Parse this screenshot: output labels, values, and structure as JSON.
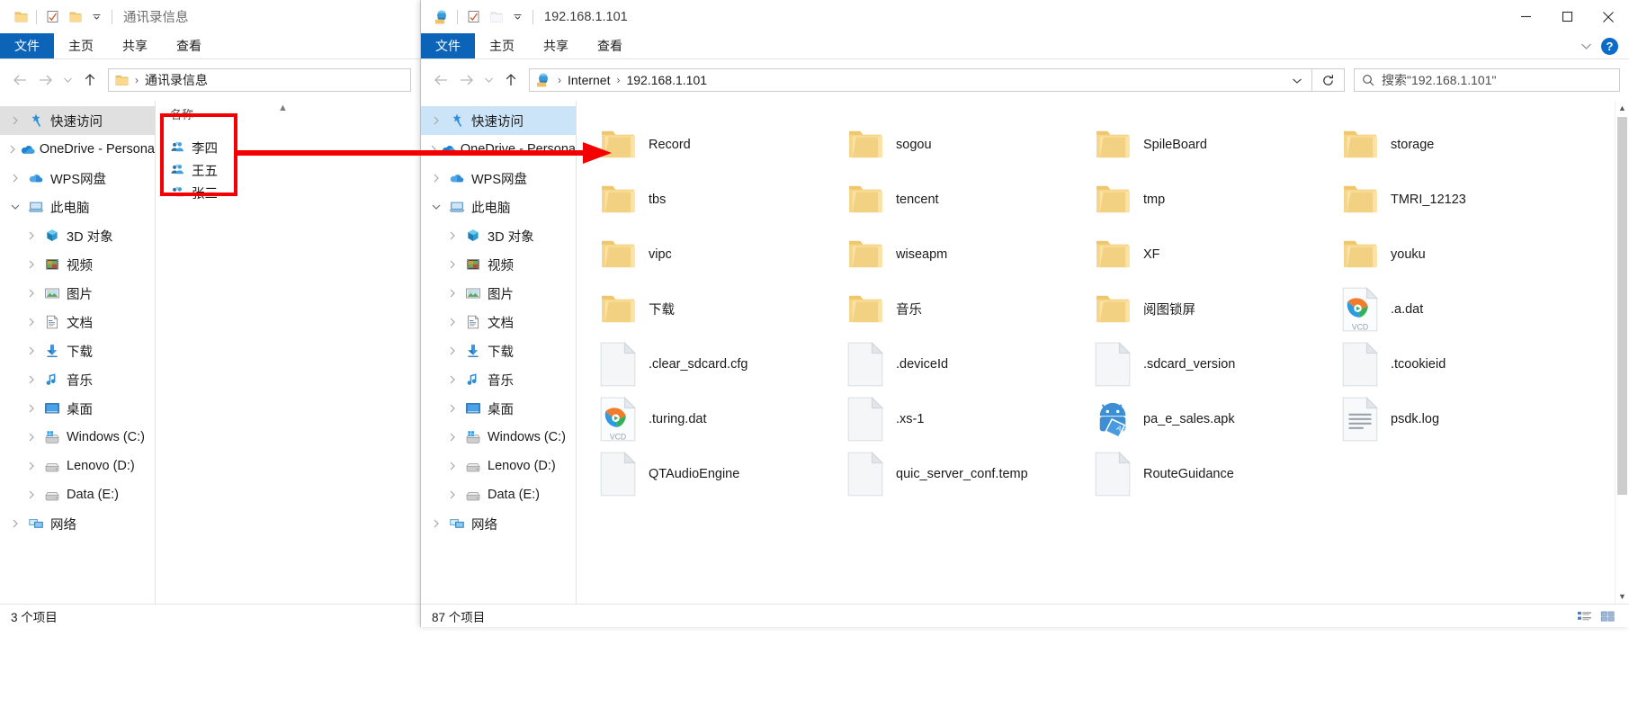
{
  "left_window": {
    "title": "通讯录信息",
    "quick_access_icons": [
      "folder-icon",
      "properties-icon",
      "new-folder-icon",
      "customize-qat-chevron"
    ],
    "ribbon_tabs": [
      "文件",
      "主页",
      "共享",
      "查看"
    ],
    "address": {
      "root_icon": "folder-icon",
      "crumbs": [
        "通讯录信息"
      ]
    },
    "nav_tree": [
      {
        "label": "快速访问",
        "icon": "star-pin-icon",
        "indent": 0,
        "expander": "chevron-right",
        "selected": true
      },
      {
        "label": "OneDrive - Persona",
        "icon": "onedrive-icon",
        "indent": 0,
        "expander": "chevron-right"
      },
      {
        "label": "WPS网盘",
        "icon": "wps-cloud-icon",
        "indent": 0,
        "expander": "chevron-right"
      },
      {
        "label": "此电脑",
        "icon": "this-pc-icon",
        "indent": 0,
        "expander": "chevron-down"
      },
      {
        "label": "3D 对象",
        "icon": "3d-objects-icon",
        "indent": 1,
        "expander": "chevron-right"
      },
      {
        "label": "视频",
        "icon": "videos-icon",
        "indent": 1,
        "expander": "chevron-right"
      },
      {
        "label": "图片",
        "icon": "pictures-icon",
        "indent": 1,
        "expander": "chevron-right"
      },
      {
        "label": "文档",
        "icon": "documents-icon",
        "indent": 1,
        "expander": "chevron-right"
      },
      {
        "label": "下载",
        "icon": "downloads-icon",
        "indent": 1,
        "expander": "chevron-right"
      },
      {
        "label": "音乐",
        "icon": "music-icon",
        "indent": 1,
        "expander": "chevron-right"
      },
      {
        "label": "桌面",
        "icon": "desktop-icon",
        "indent": 1,
        "expander": "chevron-right"
      },
      {
        "label": "Windows (C:)",
        "icon": "windows-drive-icon",
        "indent": 1,
        "expander": "chevron-right"
      },
      {
        "label": "Lenovo (D:)",
        "icon": "drive-icon",
        "indent": 1,
        "expander": "chevron-right"
      },
      {
        "label": "Data (E:)",
        "icon": "drive-icon",
        "indent": 1,
        "expander": "chevron-right"
      },
      {
        "label": "网络",
        "icon": "network-icon",
        "indent": 0,
        "expander": "chevron-right"
      }
    ],
    "list_header": "名称",
    "list_items": [
      {
        "label": "李四",
        "icon": "contact-group-icon"
      },
      {
        "label": "王五",
        "icon": "contact-group-icon"
      },
      {
        "label": "张三",
        "icon": "contact-group-icon"
      }
    ],
    "status": "3 个项目"
  },
  "right_window": {
    "title": "192.168.1.101",
    "quick_access_icons": [
      "portable-device-icon",
      "properties-icon",
      "new-folder-icon",
      "customize-qat-chevron"
    ],
    "ribbon_tabs": [
      "文件",
      "主页",
      "共享",
      "查看"
    ],
    "help_label": "?",
    "window_controls": {
      "minimize": "minimize-icon",
      "maximize": "maximize-icon",
      "close": "close-icon"
    },
    "address": {
      "root_icon": "portable-device-icon",
      "crumbs": [
        "Internet",
        "192.168.1.101"
      ]
    },
    "search_placeholder": "搜索\"192.168.1.101\"",
    "nav_tree": [
      {
        "label": "快速访问",
        "icon": "star-pin-icon",
        "indent": 0,
        "expander": "chevron-right",
        "selected": true
      },
      {
        "label": "OneDrive - Persona",
        "icon": "onedrive-icon",
        "indent": 0,
        "expander": "chevron-right"
      },
      {
        "label": "WPS网盘",
        "icon": "wps-cloud-icon",
        "indent": 0,
        "expander": "chevron-right"
      },
      {
        "label": "此电脑",
        "icon": "this-pc-icon",
        "indent": 0,
        "expander": "chevron-down"
      },
      {
        "label": "3D 对象",
        "icon": "3d-objects-icon",
        "indent": 1,
        "expander": "chevron-right"
      },
      {
        "label": "视频",
        "icon": "videos-icon",
        "indent": 1,
        "expander": "chevron-right"
      },
      {
        "label": "图片",
        "icon": "pictures-icon",
        "indent": 1,
        "expander": "chevron-right"
      },
      {
        "label": "文档",
        "icon": "documents-icon",
        "indent": 1,
        "expander": "chevron-right"
      },
      {
        "label": "下载",
        "icon": "downloads-icon",
        "indent": 1,
        "expander": "chevron-right"
      },
      {
        "label": "音乐",
        "icon": "music-icon",
        "indent": 1,
        "expander": "chevron-right"
      },
      {
        "label": "桌面",
        "icon": "desktop-icon",
        "indent": 1,
        "expander": "chevron-right"
      },
      {
        "label": "Windows (C:)",
        "icon": "windows-drive-icon",
        "indent": 1,
        "expander": "chevron-right"
      },
      {
        "label": "Lenovo (D:)",
        "icon": "drive-icon",
        "indent": 1,
        "expander": "chevron-right"
      },
      {
        "label": "Data (E:)",
        "icon": "drive-icon",
        "indent": 1,
        "expander": "chevron-right"
      },
      {
        "label": "网络",
        "icon": "network-icon",
        "indent": 0,
        "expander": "chevron-right"
      }
    ],
    "items": [
      {
        "label": "Record",
        "icon": "folder-icon"
      },
      {
        "label": "sogou",
        "icon": "folder-icon"
      },
      {
        "label": "SpileBoard",
        "icon": "folder-icon"
      },
      {
        "label": "storage",
        "icon": "folder-icon"
      },
      {
        "label": "tbs",
        "icon": "folder-icon"
      },
      {
        "label": "tencent",
        "icon": "folder-icon"
      },
      {
        "label": "tmp",
        "icon": "folder-icon"
      },
      {
        "label": "TMRI_12123",
        "icon": "folder-icon"
      },
      {
        "label": "vipc",
        "icon": "folder-icon"
      },
      {
        "label": "wiseapm",
        "icon": "folder-icon"
      },
      {
        "label": "XF",
        "icon": "folder-icon"
      },
      {
        "label": "youku",
        "icon": "folder-icon"
      },
      {
        "label": "下载",
        "icon": "folder-icon"
      },
      {
        "label": "音乐",
        "icon": "folder-icon"
      },
      {
        "label": "阅图锁屏",
        "icon": "folder-icon"
      },
      {
        "label": ".a.dat",
        "icon": "vcd-player-icon"
      },
      {
        "label": ".clear_sdcard.cfg",
        "icon": "blank-file-icon"
      },
      {
        "label": ".deviceId",
        "icon": "blank-file-icon"
      },
      {
        "label": ".sdcard_version",
        "icon": "blank-file-icon"
      },
      {
        "label": ".tcookieid",
        "icon": "blank-file-icon"
      },
      {
        "label": ".turing.dat",
        "icon": "vcd-player-icon"
      },
      {
        "label": ".xs-1",
        "icon": "blank-file-icon"
      },
      {
        "label": "pa_e_sales.apk",
        "icon": "apk-icon"
      },
      {
        "label": "psdk.log",
        "icon": "text-file-icon"
      },
      {
        "label": "QTAudioEngine",
        "icon": "blank-file-icon"
      },
      {
        "label": "quic_server_conf.temp",
        "icon": "blank-file-icon"
      },
      {
        "label": "RouteGuidance",
        "icon": "blank-file-icon"
      }
    ],
    "status": "87 个项目",
    "view_toggles": [
      "details-view-icon",
      "large-icons-view-icon"
    ]
  },
  "annotations": {
    "highlight_box_color": "#f50000",
    "arrow_color": "#f50000",
    "arrow_note": "red arrow from contact list to right window nav pane"
  }
}
